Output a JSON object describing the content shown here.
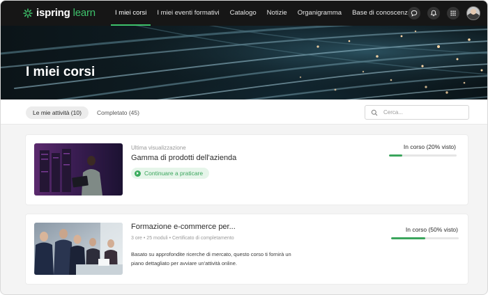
{
  "brand": {
    "name_part1": "ispring",
    "name_part2": " learn",
    "accent_color": "#3ec26b"
  },
  "nav": {
    "items": [
      {
        "label": "I miei corsi",
        "active": true
      },
      {
        "label": "I miei eventi formativi",
        "active": false
      },
      {
        "label": "Catalogo",
        "active": false
      },
      {
        "label": "Notizie",
        "active": false
      },
      {
        "label": "Organigramma",
        "active": false
      },
      {
        "label": "Base di conoscenza",
        "active": false
      }
    ],
    "icons": [
      "chat-icon",
      "bell-icon",
      "apps-grid-icon",
      "user-avatar"
    ]
  },
  "hero": {
    "title": "I miei corsi"
  },
  "filters": {
    "tab_active": "Le mie attività (10)",
    "tab_other": "Completato (45)",
    "search_placeholder": "Cerca..."
  },
  "courses": [
    {
      "meta": "Ultima visualizzazione",
      "title": "Gamma di prodotti dell'azienda",
      "action_label": "Continuare a praticare",
      "status": "In corso (20% visto)",
      "progress_fraction": 0.2
    },
    {
      "title": "Formazione e-commerce per...",
      "meta": "3 ore • 25 moduli • Certificato di completamento",
      "description": "Basato su approfondite ricerche di mercato, questo corso ti fornirà un piano dettagliato per avviare un'attività online.",
      "status": "In corso (50% visto)",
      "progress_fraction": 0.5
    }
  ]
}
